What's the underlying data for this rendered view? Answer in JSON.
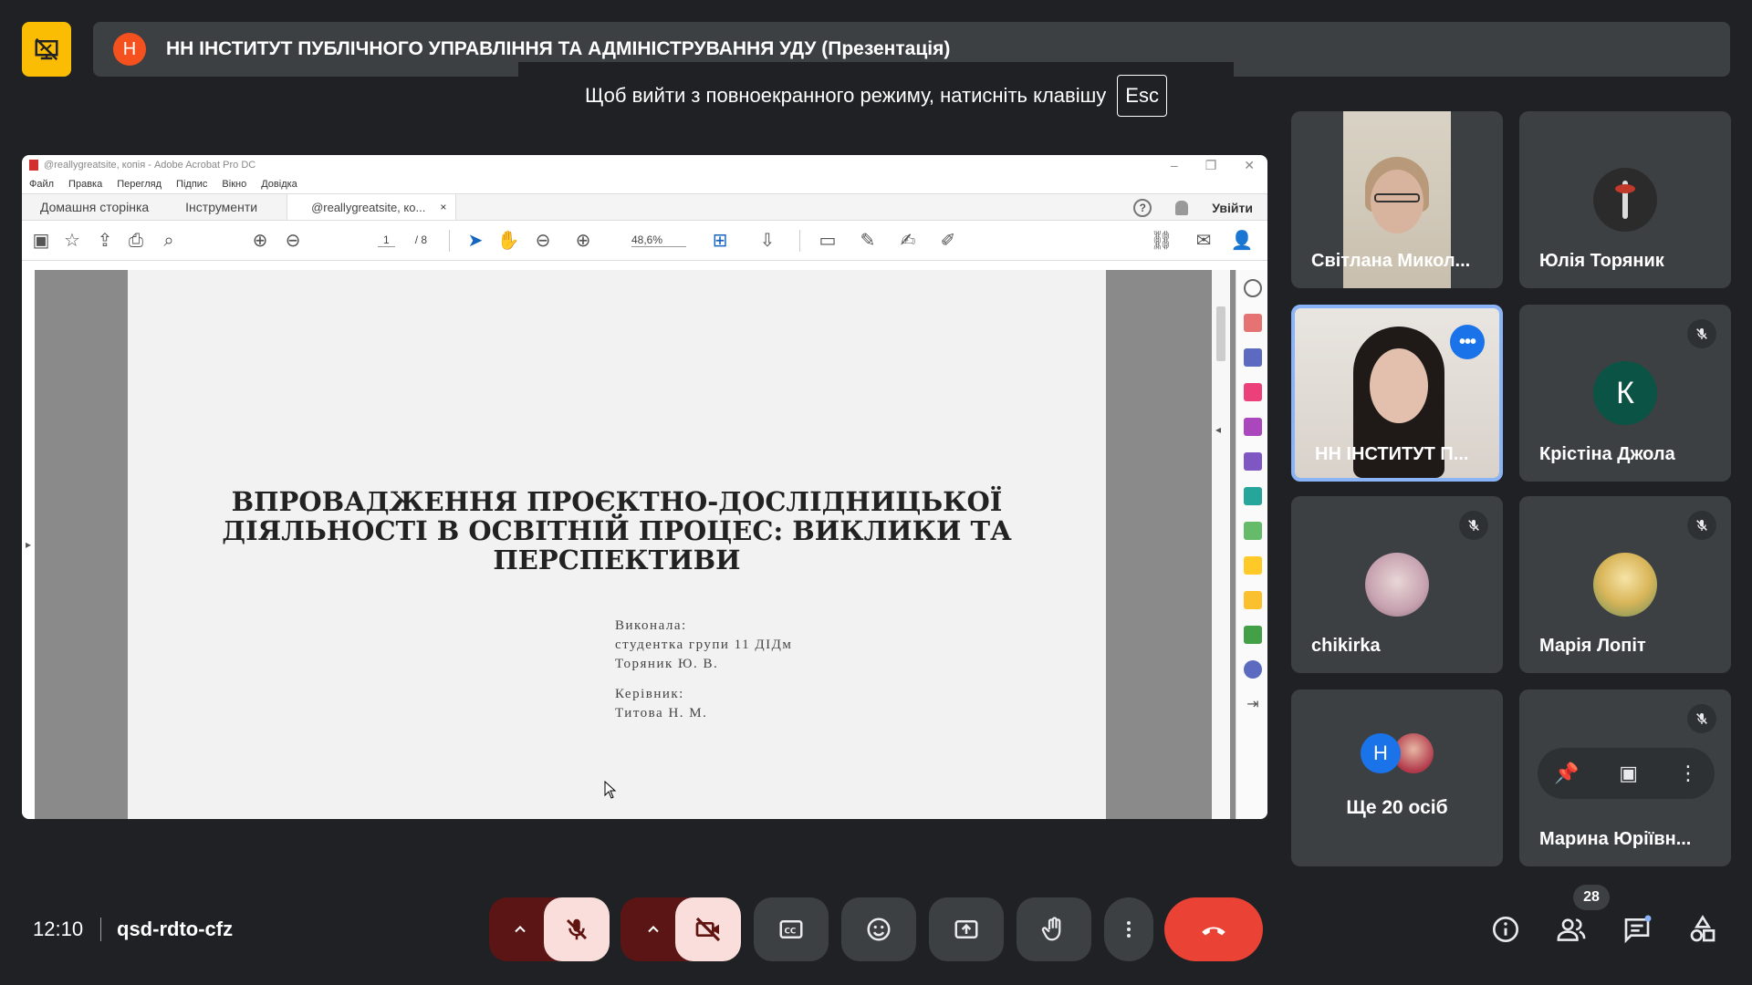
{
  "header": {
    "avatar_letter": "Н",
    "title": "НН ІНСТИТУТ ПУБЛІЧНОГО УПРАВЛІННЯ ТА АДМІНІСТРУВАННЯ УДУ (Презентація)",
    "esc_hint": "Щоб вийти з повноекранного режиму, натисніть клавішу",
    "esc_key": "Esc"
  },
  "acrobat": {
    "window_title": "@reallygreatsite, копія - Adobe Acrobat Pro DC",
    "menu": [
      "Файл",
      "Правка",
      "Перегляд",
      "Підпис",
      "Вікно",
      "Довідка"
    ],
    "tabs": {
      "home": "Домашня сторінка",
      "tools": "Інструменти",
      "doc": "@reallygreatsite, ко...",
      "close": "×"
    },
    "login": "Увійти",
    "help": "?",
    "page_current": "1",
    "page_total": "/ 8",
    "zoom": "48,6%",
    "document": {
      "title_lines": [
        "ВПРОВАДЖЕННЯ ПРОЄКТНО-ДОСЛІДНИЦЬКОЇ",
        "ДІЯЛЬНОСТІ В ОСВІТНІЙ ПРОЦЕС: ВИКЛИКИ ТА",
        "ПЕРСПЕКТИВИ"
      ],
      "author_label": "Виконала:",
      "author_group": "студентка групи 11 ДІДм",
      "author_name": "Торяник Ю. В.",
      "advisor_label": "Керівник:",
      "advisor_name": "Титова Н. М."
    }
  },
  "participants": [
    {
      "name": "Світлана Микол..."
    },
    {
      "name": "Юлія Торяник"
    },
    {
      "name": "НН ІНСТИТУТ П..."
    },
    {
      "name": "Крістіна Джола",
      "letter": "К"
    },
    {
      "name": "chikirka"
    },
    {
      "name": "Марія Лопіт"
    },
    {
      "name": "Ще 20 осіб",
      "letter": "Н"
    },
    {
      "name": "Марина Юріївн..."
    }
  ],
  "footer": {
    "time": "12:10",
    "meeting_code": "qsd-rdto-cfz",
    "participant_count": "28"
  },
  "colors": {
    "accent_yellow": "#fbbc04",
    "end_call_red": "#ea4335",
    "muted_btn_bg": "#f9dedc",
    "active_border": "#8ab4f8"
  }
}
